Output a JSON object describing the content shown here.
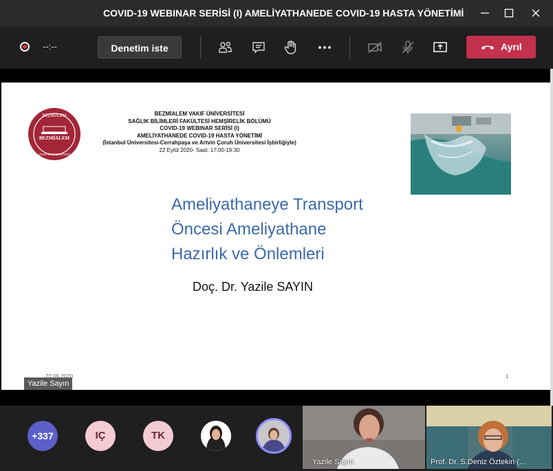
{
  "window": {
    "title": "COVID-19 WEBINAR SERİSİ (I) AMELİYATHANEDE COVID-19 HASTA YÖNETİMİ"
  },
  "toolbar": {
    "timer": "--:--",
    "request_control_label": "Denetim iste",
    "leave_label": "Ayrıl",
    "leave_color": "#c4314b"
  },
  "slide": {
    "header_lines": [
      "BEZMİALEM VAKIF ÜNİVERSİTESİ",
      "SAĞLIK BİLİMLERİ FAKÜLTESİ HEMŞİRELİK BÖLÜMÜ",
      "COVID-19 WEBINAR SERİSİ (I)",
      "AMELİYATHANEDE COVID-19 HASTA YÖNETİMİ",
      "(İstanbul Üniversitesi-Cerrahpaşa ve Artvin Çoruh Üniversitesi İşbirliğiyle)",
      "22 Eylül 2020- Saat: 17:00-19:30"
    ],
    "logo_text_top": "BEZMİALEM",
    "logo_text_mid": "BEZMİALEM",
    "logo_text_bottom": "VAKIF ÜNİVERSİTESİ",
    "title_lines": [
      "Ameliyathaneye Transport",
      "Öncesi Ameliyathane",
      "Hazırlık ve Önlemleri"
    ],
    "author": "Doç. Dr. Yazile SAYIN",
    "date": "22.09.2020",
    "page": "1",
    "title_color": "#3b6aa8"
  },
  "presenter_tag": "Yazile Sayın",
  "participants": {
    "overflow": "+337",
    "initials": [
      "IÇ",
      "TK"
    ]
  },
  "tiles": [
    {
      "name": "Yazile Sayın"
    },
    {
      "name": "Prof. Dr. S.Deniz Öztekin (..."
    }
  ]
}
